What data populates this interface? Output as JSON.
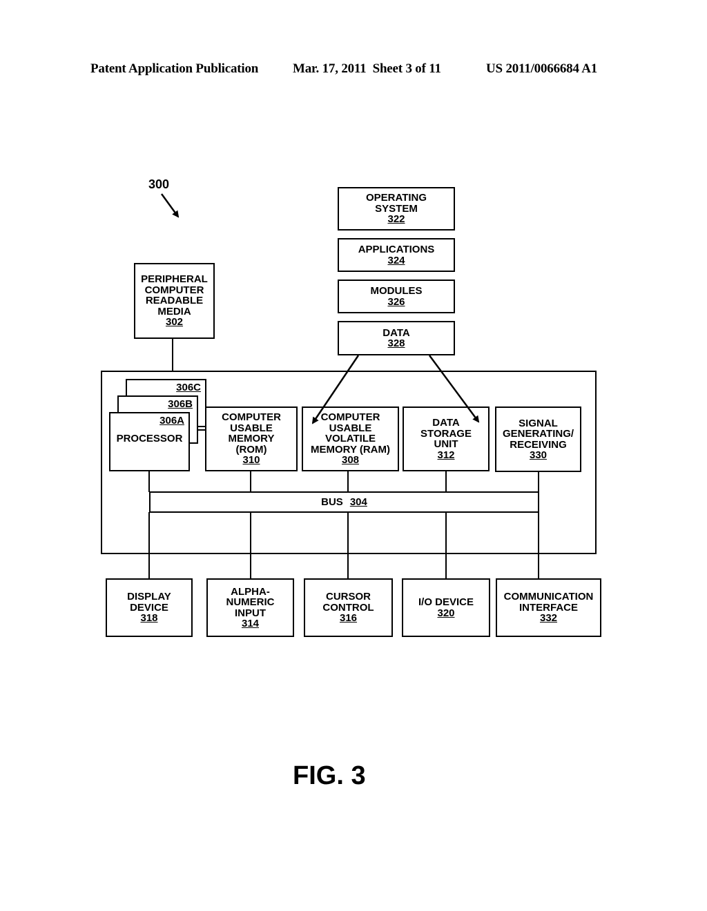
{
  "header": {
    "publication": "Patent Application Publication",
    "date_sheet": "Mar. 17, 2011  Sheet 3 of 11",
    "number": "US 2011/0066684 A1"
  },
  "figure": {
    "system_ref": "300",
    "caption": "FIG. 3"
  },
  "software_stack": [
    {
      "label": "OPERATING SYSTEM",
      "lines": [
        "OPERATING",
        "SYSTEM"
      ],
      "ref": "322"
    },
    {
      "label": "APPLICATIONS",
      "lines": [
        "APPLICATIONS"
      ],
      "ref": "324"
    },
    {
      "label": "MODULES",
      "lines": [
        "MODULES"
      ],
      "ref": "326"
    },
    {
      "label": "DATA",
      "lines": [
        "DATA"
      ],
      "ref": "328"
    }
  ],
  "peripheral": {
    "lines": [
      "PERIPHERAL",
      "COMPUTER",
      "READABLE",
      "MEDIA"
    ],
    "ref": "302"
  },
  "processors": {
    "label": "PROCESSOR",
    "refs": [
      "306A",
      "306B",
      "306C"
    ]
  },
  "internal": [
    {
      "lines": [
        "COMPUTER",
        "USABLE",
        "MEMORY",
        "(ROM)"
      ],
      "ref": "310"
    },
    {
      "lines": [
        "COMPUTER",
        "USABLE",
        "VOLATILE",
        "MEMORY (RAM)"
      ],
      "ref": "308"
    },
    {
      "lines": [
        "DATA",
        "STORAGE",
        "UNIT"
      ],
      "ref": "312"
    },
    {
      "lines": [
        "SIGNAL",
        "GENERATING/",
        "RECEIVING"
      ],
      "ref": "330"
    }
  ],
  "bus": {
    "label": "BUS",
    "ref": "304"
  },
  "external": [
    {
      "lines": [
        "DISPLAY",
        "DEVICE"
      ],
      "ref": "318"
    },
    {
      "lines": [
        "ALPHA-",
        "NUMERIC",
        "INPUT"
      ],
      "ref": "314"
    },
    {
      "lines": [
        "CURSOR",
        "CONTROL"
      ],
      "ref": "316"
    },
    {
      "lines": [
        "I/O DEVICE"
      ],
      "ref": "320"
    },
    {
      "lines": [
        "COMMUNICATION",
        "INTERFACE"
      ],
      "ref": "332"
    }
  ]
}
